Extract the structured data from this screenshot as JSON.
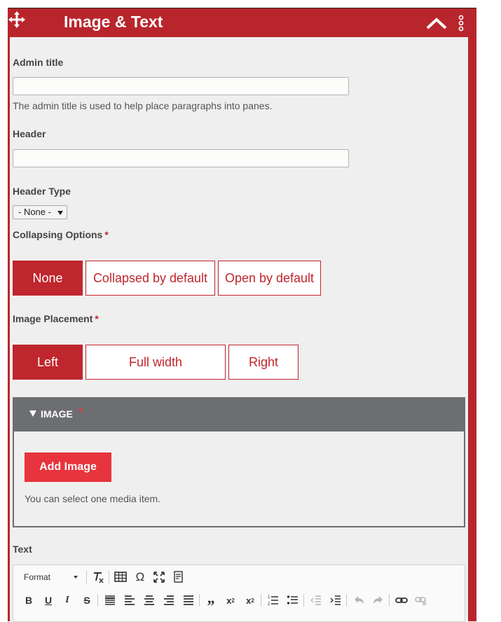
{
  "window": {
    "title": "Image & Text"
  },
  "form": {
    "admin_title": {
      "label": "Admin title",
      "value": "",
      "description": "The admin title is used to help place paragraphs into panes."
    },
    "header": {
      "label": "Header",
      "value": ""
    },
    "header_type": {
      "label": "Header Type",
      "selected": "- None -"
    },
    "collapsing": {
      "label": "Collapsing Options",
      "required_mark": "*",
      "options": [
        "None",
        "Collapsed by default",
        "Open by default"
      ],
      "selected": "None"
    },
    "placement": {
      "label": "Image Placement",
      "required_mark": "*",
      "options": [
        "Left",
        "Full width",
        "Right"
      ],
      "selected": "Left"
    },
    "image": {
      "heading": "IMAGE",
      "required_mark": "*",
      "add_label": "Add Image",
      "note": "You can select one media item."
    },
    "text": {
      "label": "Text",
      "format_label": "Format"
    }
  },
  "colors": {
    "accent": "#c0262d",
    "frame": "#b9252c",
    "add_button": "#e8343c",
    "image_header": "#6d6e71"
  }
}
